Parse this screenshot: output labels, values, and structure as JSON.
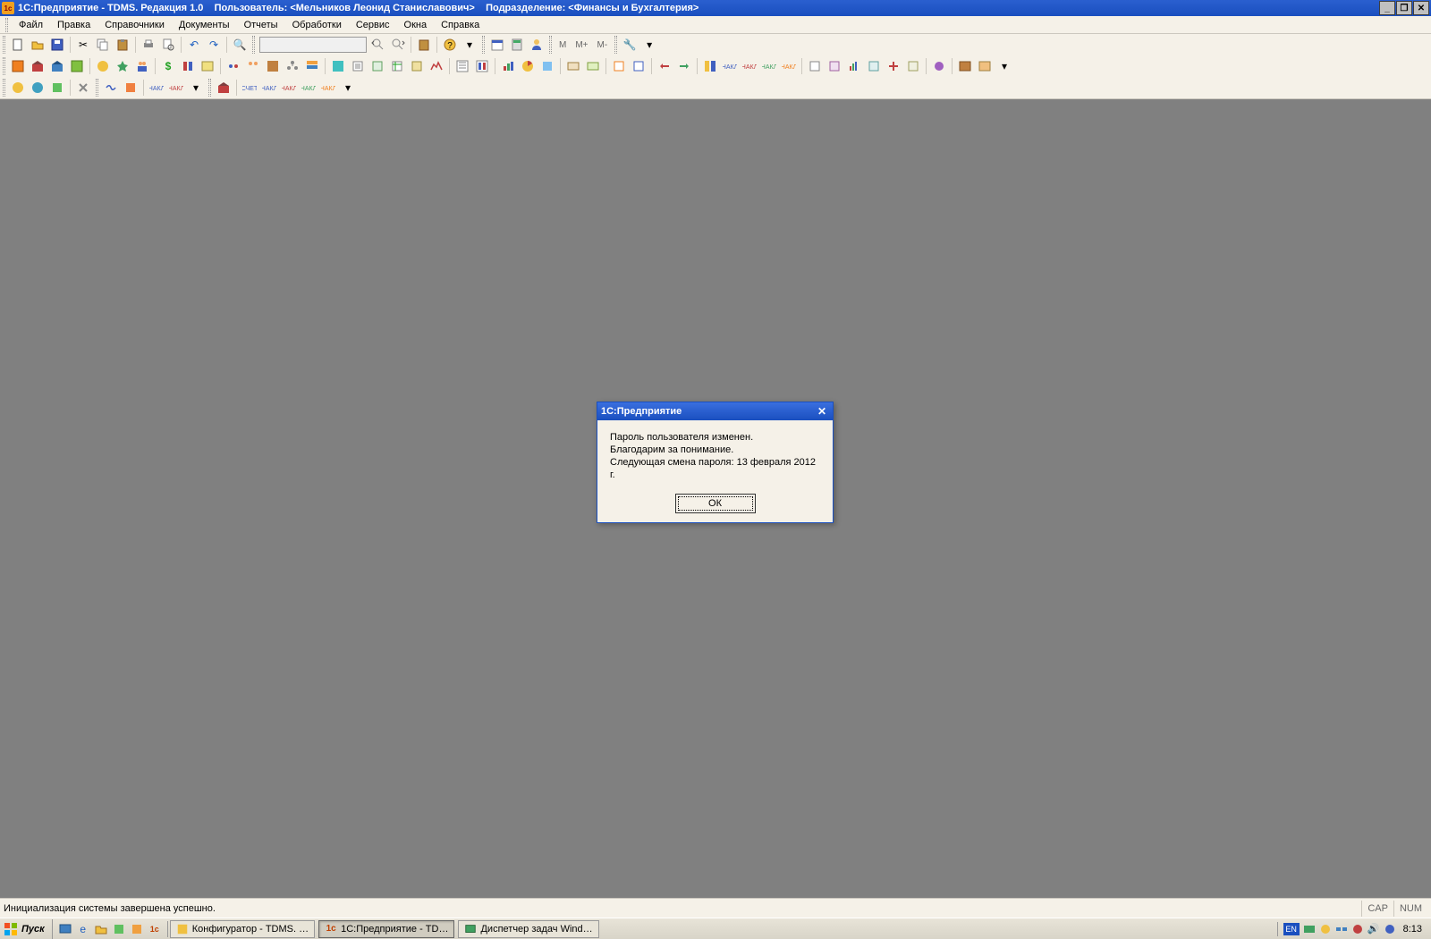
{
  "titlebar": {
    "app_name": "1С:Предприятие - TDMS. Редакция 1.0",
    "user_label": "Пользователь: <Мельников Леонид Станиславович>",
    "dept_label": "Подразделение: <Финансы и Бухгалтерия>"
  },
  "menu": {
    "items": [
      {
        "label": "Файл"
      },
      {
        "label": "Правка"
      },
      {
        "label": "Справочники"
      },
      {
        "label": "Документы"
      },
      {
        "label": "Отчеты"
      },
      {
        "label": "Обработки"
      },
      {
        "label": "Сервис"
      },
      {
        "label": "Окна"
      },
      {
        "label": "Справка"
      }
    ]
  },
  "toolbar1_m": {
    "m": "M",
    "mplus": "M+",
    "mminus": "M-"
  },
  "dialog": {
    "title": "1С:Предприятие",
    "line1": "Пароль пользователя изменен.",
    "line2": "Благодарим за понимание.",
    "line3": "Следующая смена пароля: 13 февраля 2012 г.",
    "ok_label": "ОК"
  },
  "statusbar": {
    "text": "Инициализация системы завершена успешно.",
    "cap": "CAP",
    "num": "NUM"
  },
  "taskbar": {
    "start": "Пуск",
    "tasks": [
      {
        "icon": "⚙",
        "label": "Конфигуратор - TDMS. …"
      },
      {
        "icon": "1с",
        "label": "1С:Предприятие - TD…",
        "active": true
      },
      {
        "icon": "🗔",
        "label": "Диспетчер задач Wind…"
      }
    ],
    "lang": "EN",
    "clock": "8:13"
  }
}
